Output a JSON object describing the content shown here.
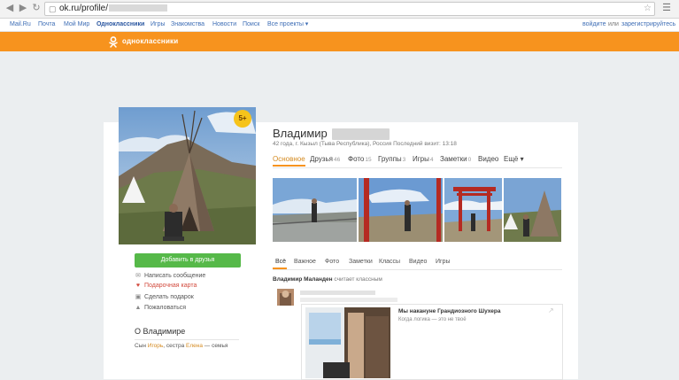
{
  "browser": {
    "url_prefix": "ok.ru/profile/",
    "back_icon": "arrow-left-icon",
    "forward_icon": "arrow-right-icon",
    "reload_icon": "reload-icon"
  },
  "portal": {
    "links": [
      "Mail.Ru",
      "Почта",
      "Мой Мир",
      "Одноклассники",
      "Игры",
      "Знакомства",
      "Новости",
      "Поиск",
      "Все проекты ▾"
    ],
    "login": "войдите",
    "or": "или",
    "register": "зарегистрируйтесь"
  },
  "header": {
    "logo_text": "одноклассники",
    "accent": "#f7931e"
  },
  "profile": {
    "badge": "5+",
    "name": "Владимир",
    "info": "42 года, г. Кызыл (Тыва Республика), Россия  Последний визит: 13:18",
    "tabs": [
      {
        "label": "Основное",
        "count": ""
      },
      {
        "label": "Друзья",
        "count": "46"
      },
      {
        "label": "Фото",
        "count": "15"
      },
      {
        "label": "Группы",
        "count": "3"
      },
      {
        "label": "Игры",
        "count": "4"
      },
      {
        "label": "Заметки",
        "count": "0"
      },
      {
        "label": "Видео",
        "count": ""
      },
      {
        "label": "Ещё ▾",
        "count": ""
      }
    ]
  },
  "actions": {
    "add_friend": "Добавить в друзья",
    "message": "Написать сообщение",
    "gift_card": "Подарочная карта",
    "gift": "Сделать подарок",
    "complain": "Пожаловаться"
  },
  "about": {
    "title": "О Владимире",
    "prefix": "Сын ",
    "son": "Игорь",
    "middle": ", сестра ",
    "sister": "Елена",
    "suffix": " — семья"
  },
  "feed": {
    "tabs": [
      "Всё",
      "Важное",
      "Фото",
      "Заметки",
      "Классы",
      "Видео",
      "Игры"
    ],
    "event_author": "Владимир Маланден",
    "event_text": " считает классным",
    "post_title": "Мы накануне Грандиозного Шухера",
    "post_subtitle": "Когда логика — это не твоё"
  }
}
